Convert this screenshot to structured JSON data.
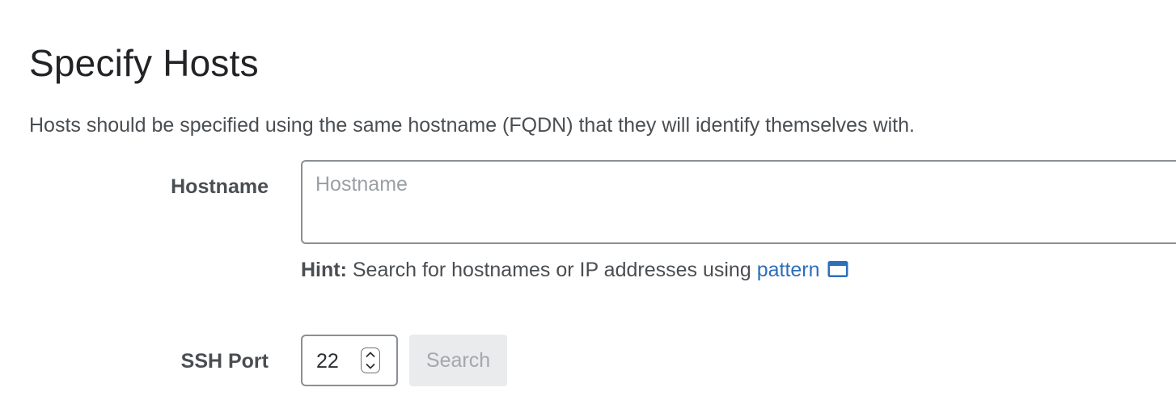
{
  "page": {
    "title": "Specify Hosts",
    "description": "Hosts should be specified using the same hostname (FQDN) that they will identify themselves with."
  },
  "hostname": {
    "label": "Hostname",
    "placeholder": "Hostname",
    "value": ""
  },
  "hint": {
    "label": "Hint:",
    "text": " Search for hostnames or IP addresses using ",
    "link_text": "pattern",
    "link_icon": "external-window-icon"
  },
  "ssh_port": {
    "label": "SSH Port",
    "value": "22"
  },
  "search_button": {
    "label": "Search",
    "disabled": true
  },
  "colors": {
    "link": "#2c6fbb",
    "input_border": "#8a8f94",
    "disabled_button_bg": "#e9ebec",
    "disabled_button_text": "#a3a8ac"
  }
}
